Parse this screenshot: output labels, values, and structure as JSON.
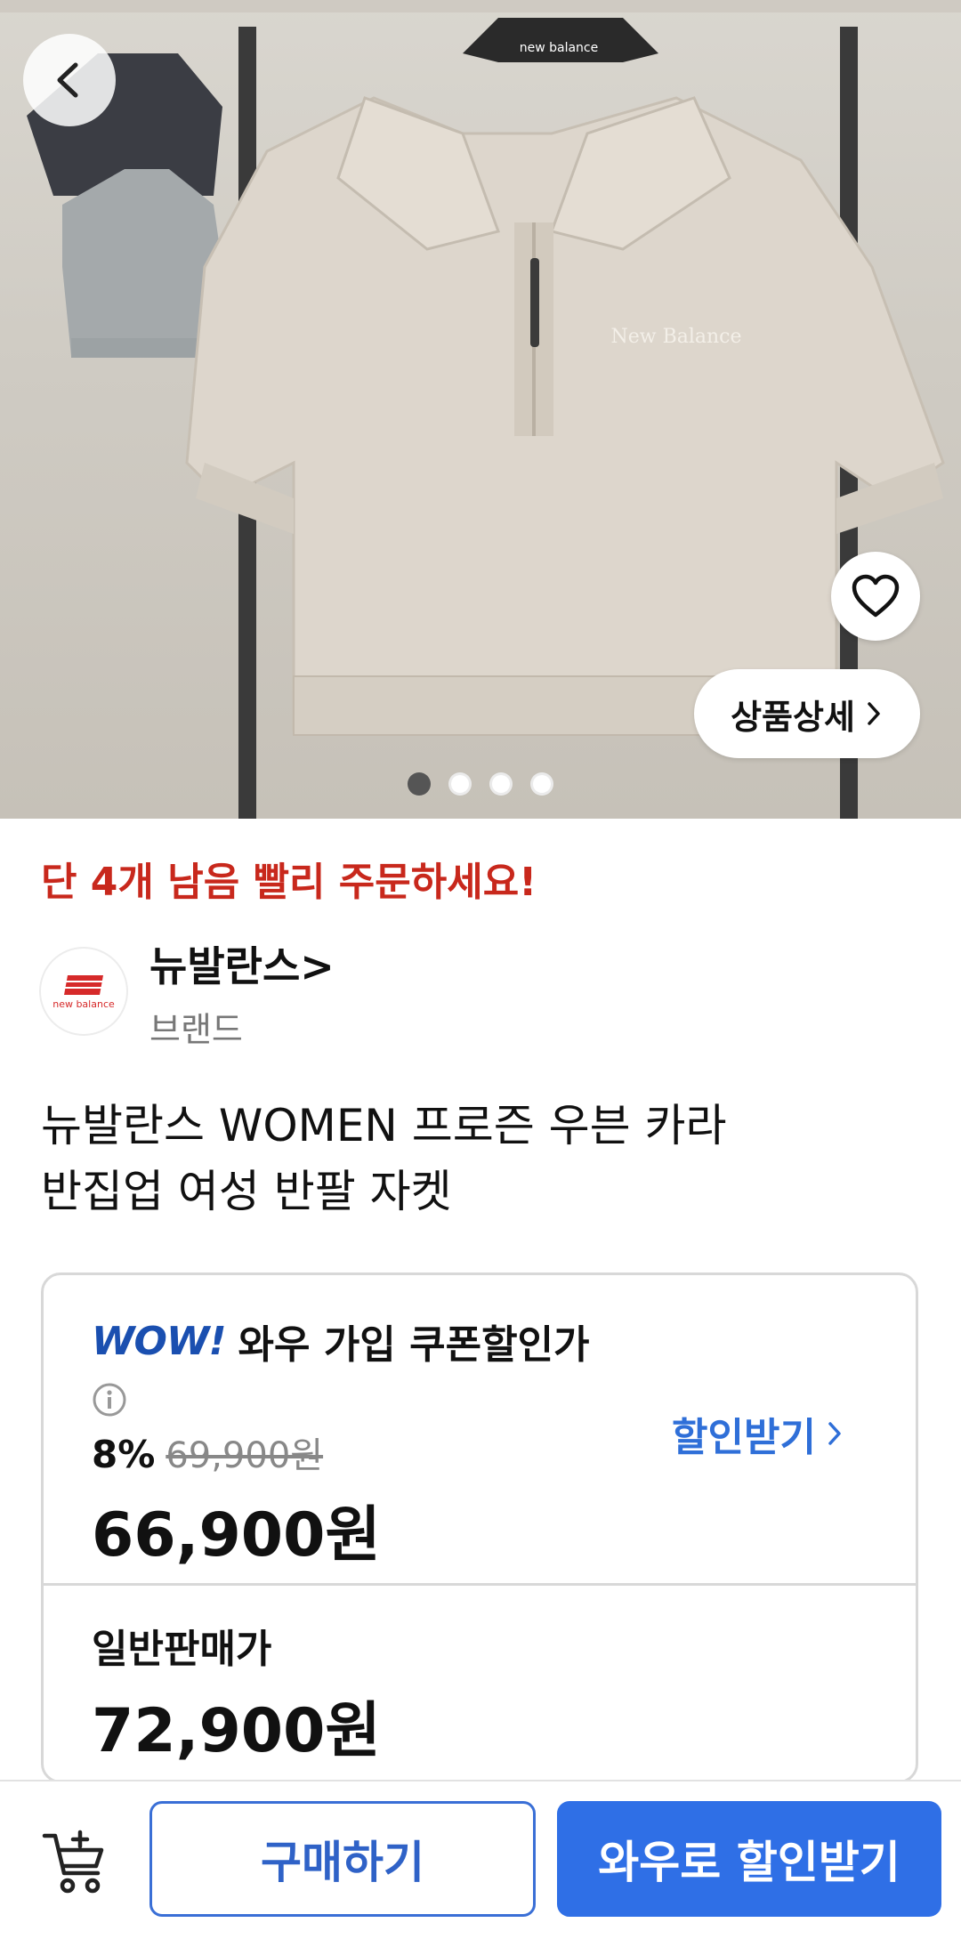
{
  "gallery": {
    "detail_label": "상품상세",
    "dots": [
      true,
      false,
      false,
      false
    ],
    "hanger_brand": "new balance",
    "shirt_logo": "New Balance"
  },
  "stock_notice": "단 4개 남음 빨리 주문하세요!",
  "brand": {
    "name": "뉴발란스",
    "name_chevron": ">",
    "type": "브랜드",
    "logo_text": "new balance"
  },
  "product": {
    "title_line1": "뉴발란스 WOMEN 프로즌 우븐 카라",
    "title_line2": "반집업 여성 반팔 자켓"
  },
  "price": {
    "wow_logo": "WOW!",
    "wow_label": "와우 가입 쿠폰할인가",
    "discount_pct": "8%",
    "original_price": "69,900원",
    "sale_price": "66,900원",
    "get_discount_label": "할인받기",
    "normal_label": "일반판매가",
    "normal_price": "72,900원"
  },
  "actions": {
    "buy_label": "구매하기",
    "wow_discount_label": "와우로 할인받기"
  },
  "colors": {
    "accent_blue": "#2f6fe6",
    "urgency_red": "#c8281c",
    "brand_red": "#d62a2a"
  }
}
